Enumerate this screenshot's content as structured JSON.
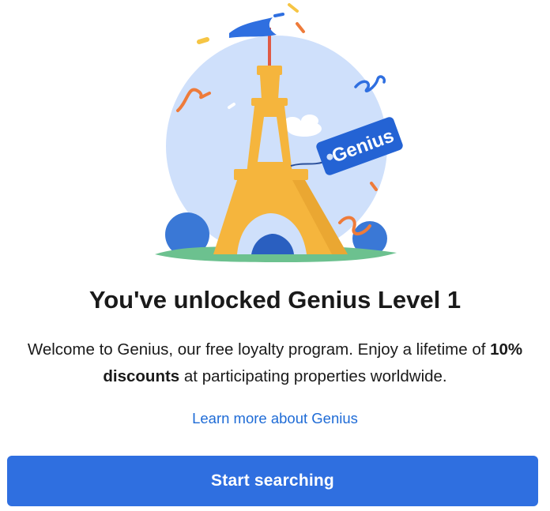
{
  "illustration": {
    "badge_text": "Genius",
    "colors": {
      "sky_circle": "#cfe0fb",
      "tower": "#f5b53d",
      "tower_shadow": "#e09a2a",
      "grass": "#6cc18f",
      "bush": "#3a78d6",
      "flag": "#2f6fe0",
      "badge": "#2463d4",
      "confetti_orange": "#ee7b3a",
      "confetti_yellow": "#f6c544"
    }
  },
  "dialog": {
    "title": "You've unlocked Genius Level 1",
    "description_prefix": "Welcome to Genius, our free loyalty program. Enjoy a lifetime of ",
    "description_bold": "10% discounts",
    "description_suffix": " at participating properties worldwide.",
    "learn_more_link": "Learn more about Genius",
    "start_button": "Start searching"
  },
  "theme": {
    "primary": "#2f6fe0",
    "link": "#1e6bd6",
    "text": "#1a1a1a"
  }
}
